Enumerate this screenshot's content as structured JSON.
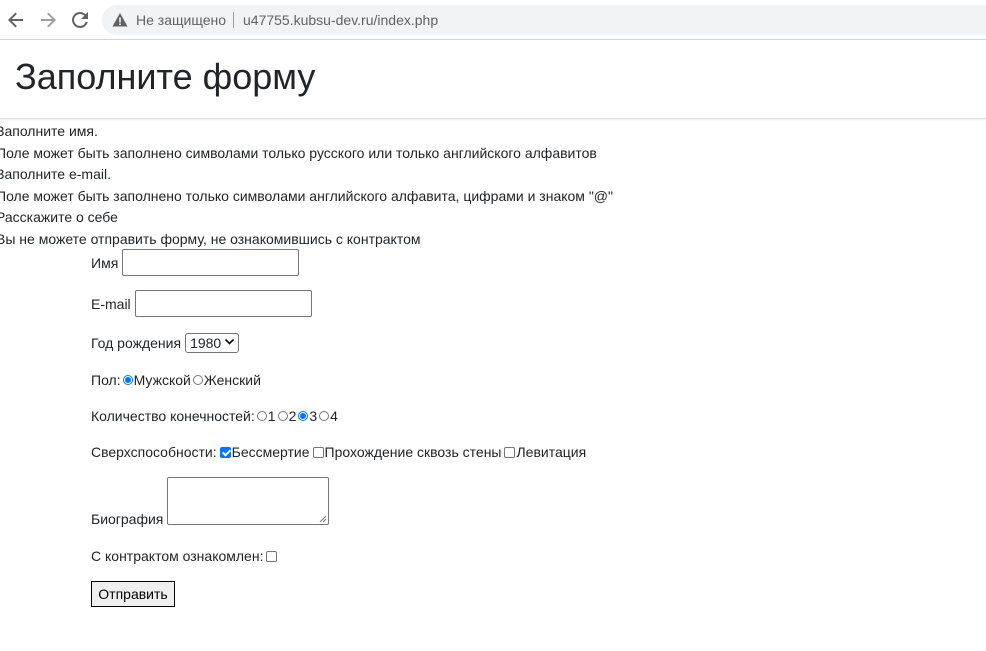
{
  "browser": {
    "insecure_label": "Не защищено",
    "url": "u47755.kubsu-dev.ru/index.php"
  },
  "header": {
    "title": "Заполните форму"
  },
  "messages": [
    "Заполните имя.",
    "Поле может быть заполнено символами только русского или только английского алфавитов",
    "Заполните e-mail.",
    "Поле может быть заполнено только символами английского алфавита, цифрами и знаком \"@\"",
    "Расскажите о себе",
    "Вы не можете отправить форму, не ознакомившись с контрактом"
  ],
  "form": {
    "name_label": "Имя",
    "name_value": "",
    "email_label": "E-mail",
    "email_value": "",
    "year_label": "Год рождения",
    "year_value": "1980",
    "gender_label": "Пол:",
    "gender_options": [
      "Мужской",
      "Женский"
    ],
    "gender_selected": "Мужской",
    "limbs_label": "Количество конечностей:",
    "limbs_options": [
      "1",
      "2",
      "3",
      "4"
    ],
    "limbs_selected": "3",
    "powers_label": "Сверхспособности:",
    "powers_options": [
      "Бессмертие",
      "Прохождение сквозь стены",
      "Левитация"
    ],
    "powers_checked": [
      "Бессмертие"
    ],
    "bio_label": "Биография",
    "bio_value": "",
    "contract_label": "С контрактом ознакомлен:",
    "contract_checked": false,
    "submit_label": "Отправить"
  },
  "colors": {
    "accent": "#0075ff",
    "header_text": "#212529"
  }
}
